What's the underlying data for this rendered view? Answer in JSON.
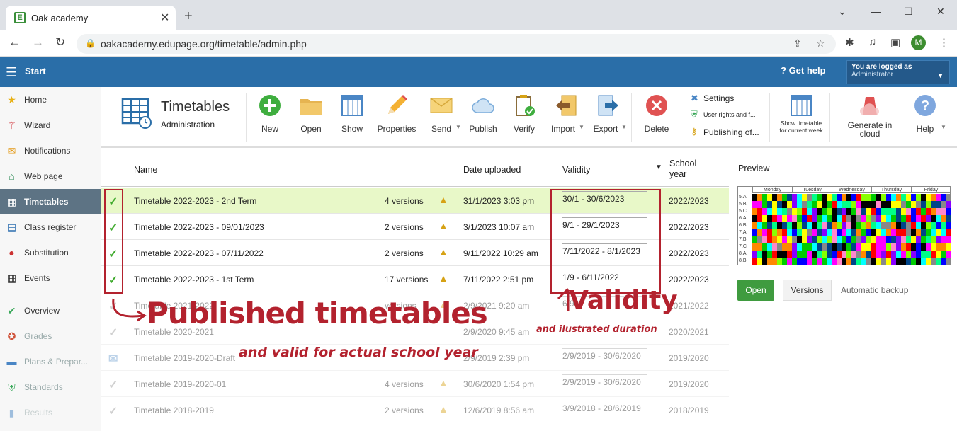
{
  "browser": {
    "tab_title": "Oak academy",
    "favicon": "E",
    "url": "oakacademy.edupage.org/timetable/admin.php",
    "avatar_letter": "M"
  },
  "header": {
    "start_label": "Start",
    "help_label": "Get help",
    "logged_line1": "You are logged as",
    "logged_line2": "Administrator"
  },
  "sidebar": {
    "items": [
      {
        "label": "Home",
        "icon": "star-icon",
        "color": "#e8b115"
      },
      {
        "label": "Wizard",
        "icon": "magic-wand-icon",
        "color": "#d0333a"
      },
      {
        "label": "Notifications",
        "icon": "envelope-icon",
        "color": "#e49b1a"
      },
      {
        "label": "Web page",
        "icon": "house-icon",
        "color": "#2e8b57"
      },
      {
        "label": "Timetables",
        "icon": "timetable-grid-icon",
        "color": "#ffffff"
      },
      {
        "label": "Class register",
        "icon": "notebook-icon",
        "color": "#2f6fb0"
      },
      {
        "label": "Substitution",
        "icon": "person-icon",
        "color": "#cc3333"
      },
      {
        "label": "Events",
        "icon": "calendar-icon",
        "color": "#333333"
      },
      {
        "label": "Overview",
        "icon": "check-circle-icon",
        "color": "#3aa85a"
      },
      {
        "label": "Grades",
        "icon": "grades-icon",
        "color": "#d0533a"
      },
      {
        "label": "Plans & Prepar...",
        "icon": "briefcase-icon",
        "color": "#4a86c5"
      },
      {
        "label": "Standards",
        "icon": "shield-icon",
        "color": "#3aa85a"
      },
      {
        "label": "Results",
        "icon": "bar-chart-icon",
        "color": "#4a86c5"
      }
    ]
  },
  "toolbar": {
    "title": "Timetables",
    "subtitle": "Administration",
    "buttons": {
      "new": "New",
      "open": "Open",
      "show": "Show",
      "properties": "Properties",
      "send": "Send",
      "publish": "Publish",
      "verify": "Verify",
      "import": "Import",
      "export": "Export",
      "delete": "Delete",
      "settings": "Settings",
      "user_rights": "User rights and f...",
      "publishing_of": "Publishing of...",
      "show_current_week": "Show timetable for current week",
      "generate_cloud": "Generate in cloud",
      "help": "Help"
    }
  },
  "table": {
    "headers": {
      "name": "Name",
      "date": "Date uploaded",
      "validity": "Validity",
      "school_year": "School year"
    },
    "rows": [
      {
        "name": "Timetable 2022-2023 - 2nd Term",
        "versions": "4 versions",
        "date": "31/1/2023 3:03 pm",
        "validity": "30/1 - 30/6/2023",
        "school_year": "2022/2023",
        "status": "published"
      },
      {
        "name": "Timetable 2022-2023 - 09/01/2023",
        "versions": "2 versions",
        "date": "3/1/2023 10:07 am",
        "validity": "9/1 - 29/1/2023",
        "school_year": "2022/2023",
        "status": "published"
      },
      {
        "name": "Timetable 2022-2023 - 07/11/2022",
        "versions": "2 versions",
        "date": "9/11/2022 10:29 am",
        "validity": "7/11/2022 - 8/1/2023",
        "school_year": "2022/2023",
        "status": "published"
      },
      {
        "name": "Timetable 2022-2023 - 1st Term",
        "versions": "17 versions",
        "date": "7/11/2022 2:51 pm",
        "validity": "1/9 - 6/11/2022",
        "school_year": "2022/2023",
        "status": "published"
      },
      {
        "name": "Timetable 2021-2022",
        "versions": "versions",
        "date": "2/9/2021 9:20 am",
        "validity": "6/9",
        "school_year": "2021/2022",
        "status": "old"
      },
      {
        "name": "Timetable 2020-2021",
        "versions": "",
        "date": "2/9/2020 9:45 am",
        "validity": "",
        "school_year": "2020/2021",
        "status": "old"
      },
      {
        "name": "Timetable 2019-2020-Draft",
        "versions": "",
        "date": "2/9/2019 2:39 pm",
        "validity": "2/9/2019 - 30/6/2020",
        "school_year": "2019/2020",
        "status": "draft"
      },
      {
        "name": "Timetable 2019-2020-01",
        "versions": "4 versions",
        "date": "30/6/2020 1:54 pm",
        "validity": "2/9/2019 - 30/6/2020",
        "school_year": "2019/2020",
        "status": "old"
      },
      {
        "name": "Timetable 2018-2019",
        "versions": "2 versions",
        "date": "12/6/2019 8:56 am",
        "validity": "3/9/2018 - 28/6/2019",
        "school_year": "2018/2019",
        "status": "old"
      }
    ]
  },
  "preview": {
    "title": "Preview",
    "days": [
      "Monday",
      "Tuesday",
      "Wednesday",
      "Thursday",
      "Friday"
    ],
    "classes": [
      "5.A",
      "5.B",
      "5.C",
      "6.A",
      "6.B",
      "7.A",
      "7.B",
      "7.C",
      "8.A",
      "8.B"
    ],
    "open_label": "Open",
    "versions_label": "Versions",
    "backup_label": "Automatic backup"
  },
  "annotations": {
    "published_title": "Published timetables",
    "published_sub": "and valid for actual school year",
    "validity_title": "Validity",
    "validity_sub": "and ilustrated duration"
  }
}
